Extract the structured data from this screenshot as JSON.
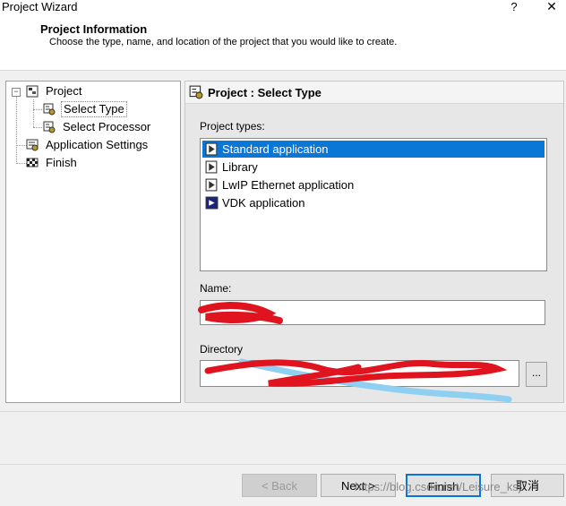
{
  "window": {
    "title": "Project Wizard",
    "help": "?",
    "close": "✕"
  },
  "header": {
    "heading": "Project Information",
    "subtext": "Choose the type, name, and location of the project that you would like to create."
  },
  "tree": {
    "items": [
      {
        "label": "Project",
        "icon": "project-icon"
      },
      {
        "label": "Select Type",
        "icon": "select-type-icon",
        "selected": true
      },
      {
        "label": "Select Processor",
        "icon": "processor-icon"
      },
      {
        "label": "Application Settings",
        "icon": "settings-icon"
      },
      {
        "label": "Finish",
        "icon": "finish-flag-icon"
      }
    ]
  },
  "panel": {
    "title": "Project : Select Type",
    "project_types_label": "Project types:",
    "types": [
      {
        "label": "Standard application",
        "selected": true
      },
      {
        "label": "Library"
      },
      {
        "label": "LwIP Ethernet application"
      },
      {
        "label": "VDK application"
      }
    ],
    "name_label": "Name:",
    "name_value": "",
    "directory_label": "Directory",
    "directory_value": "",
    "browse_label": "..."
  },
  "buttons": {
    "back": "< Back",
    "next": "Next >",
    "finish": "Finish",
    "cancel": "取消"
  },
  "watermark": "https://blog.csdn.net/Leisure_ksj",
  "colors": {
    "selection": "#0a76d6",
    "redaction_red": "#e0141e",
    "redaction_blue": "#8fd0f2"
  }
}
